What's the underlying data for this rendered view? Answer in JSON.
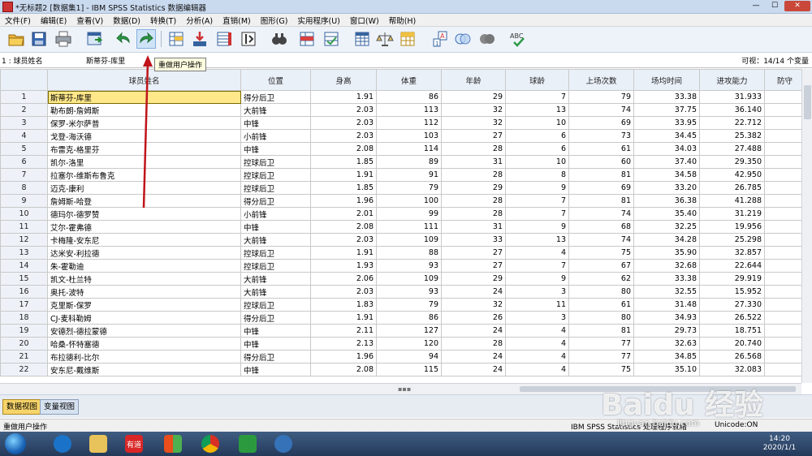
{
  "window": {
    "title": "*无标题2 [数据集1] - IBM SPSS Statistics 数据编辑器",
    "min": "—",
    "max": "☐",
    "close": "✕"
  },
  "menu": [
    "文件(F)",
    "编辑(E)",
    "查看(V)",
    "数据(D)",
    "转换(T)",
    "分析(A)",
    "直销(M)",
    "图形(G)",
    "实用程序(U)",
    "窗口(W)",
    "帮助(H)"
  ],
  "toolbar": {
    "icons": [
      "open-icon",
      "save-icon",
      "print-icon",
      "recall-dialog-icon",
      "undo-icon",
      "redo-icon",
      "goto-case-icon",
      "goto-variable-icon",
      "variables-icon",
      "run-descriptives-icon",
      "find-icon",
      "insert-cases-icon",
      "insert-variable-icon",
      "split-file-icon",
      "weight-cases-icon",
      "select-cases-icon",
      "value-labels-icon",
      "use-sets-icon",
      "show-all-variables-icon",
      "spelling-icon"
    ],
    "tooltip": "重做用户操作"
  },
  "cellbar": {
    "ref": "1 : 球员姓名",
    "value": "斯蒂芬-库里",
    "visible": "可视：14/14 个变量"
  },
  "columns": [
    "球员姓名",
    "位置",
    "身高",
    "体重",
    "年龄",
    "球龄",
    "上场次数",
    "场均时间",
    "进攻能力",
    "防守"
  ],
  "rows": [
    [
      "1",
      "斯蒂芬-库里",
      "得分后卫",
      "1.91",
      "86",
      "29",
      "7",
      "79",
      "33.38",
      "31.933"
    ],
    [
      "2",
      "勒布朗-詹姆斯",
      "大前锋",
      "2.03",
      "113",
      "32",
      "13",
      "74",
      "37.75",
      "36.140"
    ],
    [
      "3",
      "保罗-米尔萨普",
      "中锋",
      "2.03",
      "112",
      "32",
      "10",
      "69",
      "33.95",
      "22.712"
    ],
    [
      "4",
      "戈登-海沃德",
      "小前锋",
      "2.03",
      "103",
      "27",
      "6",
      "73",
      "34.45",
      "25.382"
    ],
    [
      "5",
      "布雷克-格里芬",
      "中锋",
      "2.08",
      "114",
      "28",
      "6",
      "61",
      "34.03",
      "27.488"
    ],
    [
      "6",
      "凯尔-洛里",
      "控球后卫",
      "1.85",
      "89",
      "31",
      "10",
      "60",
      "37.40",
      "29.350"
    ],
    [
      "7",
      "拉塞尔-维斯布鲁克",
      "控球后卫",
      "1.91",
      "91",
      "28",
      "8",
      "81",
      "34.58",
      "42.950"
    ],
    [
      "8",
      "迈克-康利",
      "控球后卫",
      "1.85",
      "79",
      "29",
      "9",
      "69",
      "33.20",
      "26.785"
    ],
    [
      "9",
      "詹姆斯-哈登",
      "得分后卫",
      "1.96",
      "100",
      "28",
      "7",
      "81",
      "36.38",
      "41.288"
    ],
    [
      "10",
      "德玛尔-德罗赞",
      "小前锋",
      "2.01",
      "99",
      "28",
      "7",
      "74",
      "35.40",
      "31.219"
    ],
    [
      "11",
      "艾尔-霍弗德",
      "中锋",
      "2.08",
      "111",
      "31",
      "9",
      "68",
      "32.25",
      "19.956"
    ],
    [
      "12",
      "卡梅隆-安东尼",
      "大前锋",
      "2.03",
      "109",
      "33",
      "13",
      "74",
      "34.28",
      "25.298"
    ],
    [
      "13",
      "达米安-利拉德",
      "控球后卫",
      "1.91",
      "88",
      "27",
      "4",
      "75",
      "35.90",
      "32.857"
    ],
    [
      "14",
      "朱-霍勒迪",
      "控球后卫",
      "1.93",
      "93",
      "27",
      "7",
      "67",
      "32.68",
      "22.644"
    ],
    [
      "15",
      "凯文-杜兰特",
      "大前锋",
      "2.06",
      "109",
      "29",
      "9",
      "62",
      "33.38",
      "29.919"
    ],
    [
      "16",
      "奥托-波特",
      "大前锋",
      "2.03",
      "93",
      "24",
      "3",
      "80",
      "32.55",
      "15.952"
    ],
    [
      "17",
      "克里斯-保罗",
      "控球后卫",
      "1.83",
      "79",
      "32",
      "11",
      "61",
      "31.48",
      "27.330"
    ],
    [
      "18",
      "CJ-麦科勒姆",
      "得分后卫",
      "1.91",
      "86",
      "26",
      "3",
      "80",
      "34.93",
      "26.522"
    ],
    [
      "19",
      "安德烈-德拉蒙德",
      "中锋",
      "2.11",
      "127",
      "24",
      "4",
      "81",
      "29.73",
      "18.751"
    ],
    [
      "20",
      "哈桑-怀特塞德",
      "中锋",
      "2.13",
      "120",
      "28",
      "4",
      "77",
      "32.63",
      "20.740"
    ],
    [
      "21",
      "布拉德利-比尔",
      "得分后卫",
      "1.96",
      "94",
      "24",
      "4",
      "77",
      "34.85",
      "26.568"
    ],
    [
      "22",
      "安东尼-戴维斯",
      "中锋",
      "2.08",
      "115",
      "24",
      "4",
      "75",
      "35.10",
      "32.083"
    ]
  ],
  "tabs": [
    "数据视图",
    "变量视图"
  ],
  "status": {
    "left": "重做用户操作",
    "processor": "IBM SPSS Statistics 处理程序就绪",
    "encoding": "Unicode:ON"
  },
  "taskbar": {
    "apps": [
      "sogou-icon",
      "file-explorer-icon",
      "youdao-icon",
      "office-icon",
      "chrome-icon",
      "wps-icon",
      "spss-icon"
    ],
    "youdao_label": "有道",
    "time": "14:20",
    "date": "2020/1/1"
  },
  "watermark": {
    "brand": "Baidu 经验",
    "url": "jingyan.baidu.com"
  }
}
